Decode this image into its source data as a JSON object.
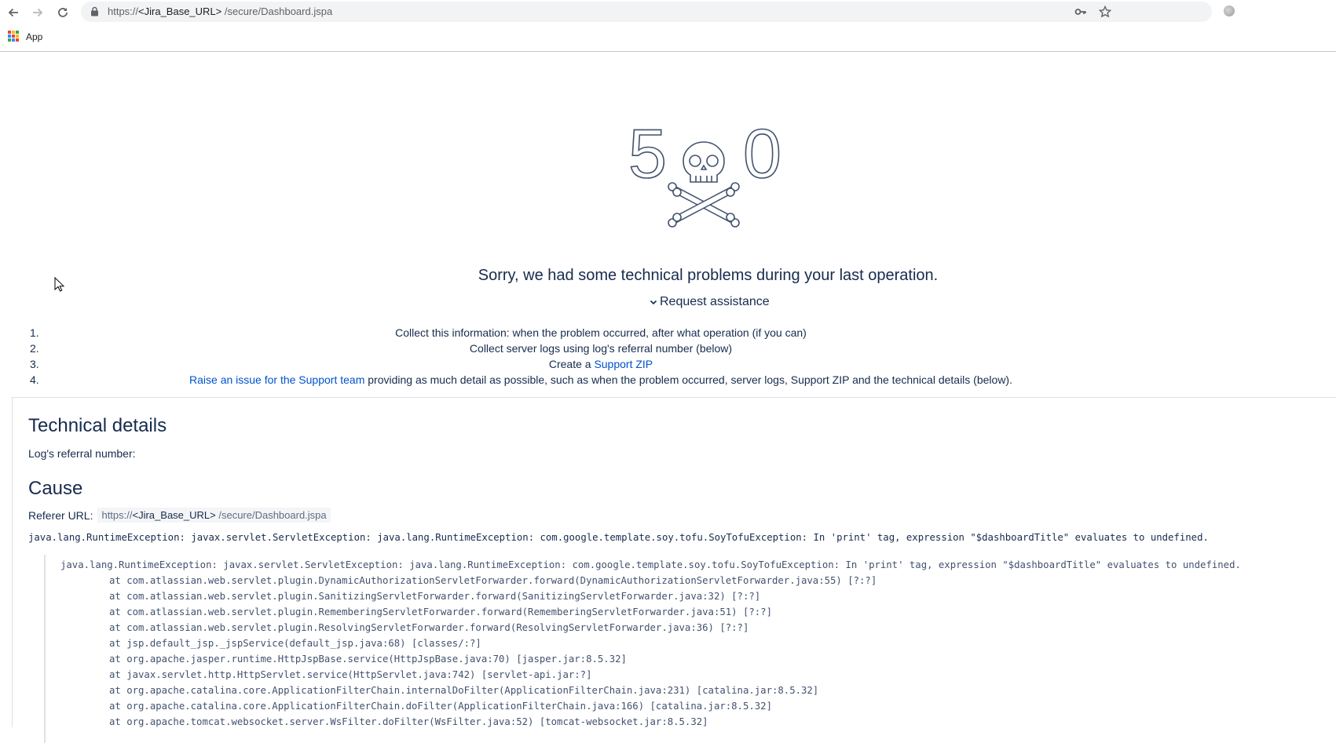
{
  "browser": {
    "url_protocol": "https://",
    "url_host": "<Jira_Base_URL>",
    "url_path": " /secure/Dashboard.jspa",
    "bookmarks": {
      "apps_label": "App"
    },
    "apps_colors": [
      "#ea4335",
      "#fbbc04",
      "#34a853",
      "#4285f4",
      "#ea4335",
      "#fbbc04",
      "#34a853",
      "#4285f4",
      "#ea4335"
    ]
  },
  "error": {
    "code_left": "5",
    "code_right": "0",
    "message": "Sorry, we had some technical problems during your last operation.",
    "request_assistance": "Request assistance",
    "steps": [
      {
        "num": "1.",
        "text": "Collect this information: when the problem occurred, after what operation (if you can)"
      },
      {
        "num": "2.",
        "text": "Collect server logs using log's referral number (below)"
      },
      {
        "num": "3.",
        "prefix": "Create a ",
        "link": "Support ZIP"
      },
      {
        "num": "4.",
        "link": "Raise an issue for the Support team",
        "suffix": " providing as much detail as possible, such as when the problem occurred, server logs, Support ZIP and the technical details (below)."
      }
    ]
  },
  "details": {
    "heading": "Technical details",
    "referral_label": "Log's referral number:",
    "cause_heading": "Cause",
    "referer_label": "Referer URL:",
    "referer_protocol": "https://",
    "referer_host": "<Jira_Base_URL>",
    "referer_path": " /secure/Dashboard.jspa",
    "exception": "java.lang.RuntimeException: javax.servlet.ServletException: java.lang.RuntimeException: com.google.template.soy.tofu.SoyTofuException: In 'print' tag, expression \"$dashboardTitle\" evaluates to undefined.",
    "trace_first": "java.lang.RuntimeException: javax.servlet.ServletException: java.lang.RuntimeException: com.google.template.soy.tofu.SoyTofuException: In 'print' tag, expression \"$dashboardTitle\" evaluates to undefined.",
    "trace": [
      "at com.atlassian.web.servlet.plugin.DynamicAuthorizationServletForwarder.forward(DynamicAuthorizationServletForwarder.java:55) [?:?]",
      "at com.atlassian.web.servlet.plugin.SanitizingServletForwarder.forward(SanitizingServletForwarder.java:32) [?:?]",
      "at com.atlassian.web.servlet.plugin.RememberingServletForwarder.forward(RememberingServletForwarder.java:51) [?:?]",
      "at com.atlassian.web.servlet.plugin.ResolvingServletForwarder.forward(ResolvingServletForwarder.java:36) [?:?]",
      "at jsp.default_jsp._jspService(default_jsp.java:68) [classes/:?]",
      "at org.apache.jasper.runtime.HttpJspBase.service(HttpJspBase.java:70) [jasper.jar:8.5.32]",
      "at javax.servlet.http.HttpServlet.service(HttpServlet.java:742) [servlet-api.jar:?]",
      "at org.apache.catalina.core.ApplicationFilterChain.internalDoFilter(ApplicationFilterChain.java:231) [catalina.jar:8.5.32]",
      "at org.apache.catalina.core.ApplicationFilterChain.doFilter(ApplicationFilterChain.java:166) [catalina.jar:8.5.32]",
      "at org.apache.tomcat.websocket.server.WsFilter.doFilter(WsFilter.java:52) [tomcat-websocket.jar:8.5.32]"
    ]
  }
}
